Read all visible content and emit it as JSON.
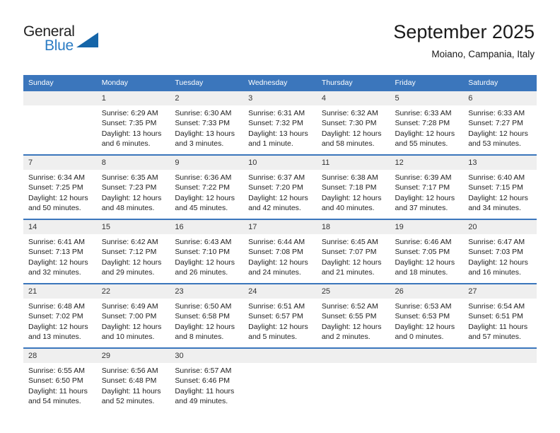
{
  "brand": {
    "name_top": "General",
    "name_bottom": "Blue",
    "triangle_color": "#1565a8",
    "blue_color": "#2b7cc4"
  },
  "header": {
    "title": "September 2025",
    "subtitle": "Moiano, Campania, Italy"
  },
  "theme": {
    "header_bar_color": "#3b76bc",
    "daynum_bg": "#efefef",
    "text_color": "#222222"
  },
  "weekdays": [
    "Sunday",
    "Monday",
    "Tuesday",
    "Wednesday",
    "Thursday",
    "Friday",
    "Saturday"
  ],
  "weeks": [
    [
      {
        "day": "",
        "lines": []
      },
      {
        "day": "1",
        "lines": [
          "Sunrise: 6:29 AM",
          "Sunset: 7:35 PM",
          "Daylight: 13 hours",
          "and 6 minutes."
        ]
      },
      {
        "day": "2",
        "lines": [
          "Sunrise: 6:30 AM",
          "Sunset: 7:33 PM",
          "Daylight: 13 hours",
          "and 3 minutes."
        ]
      },
      {
        "day": "3",
        "lines": [
          "Sunrise: 6:31 AM",
          "Sunset: 7:32 PM",
          "Daylight: 13 hours",
          "and 1 minute."
        ]
      },
      {
        "day": "4",
        "lines": [
          "Sunrise: 6:32 AM",
          "Sunset: 7:30 PM",
          "Daylight: 12 hours",
          "and 58 minutes."
        ]
      },
      {
        "day": "5",
        "lines": [
          "Sunrise: 6:33 AM",
          "Sunset: 7:28 PM",
          "Daylight: 12 hours",
          "and 55 minutes."
        ]
      },
      {
        "day": "6",
        "lines": [
          "Sunrise: 6:33 AM",
          "Sunset: 7:27 PM",
          "Daylight: 12 hours",
          "and 53 minutes."
        ]
      }
    ],
    [
      {
        "day": "7",
        "lines": [
          "Sunrise: 6:34 AM",
          "Sunset: 7:25 PM",
          "Daylight: 12 hours",
          "and 50 minutes."
        ]
      },
      {
        "day": "8",
        "lines": [
          "Sunrise: 6:35 AM",
          "Sunset: 7:23 PM",
          "Daylight: 12 hours",
          "and 48 minutes."
        ]
      },
      {
        "day": "9",
        "lines": [
          "Sunrise: 6:36 AM",
          "Sunset: 7:22 PM",
          "Daylight: 12 hours",
          "and 45 minutes."
        ]
      },
      {
        "day": "10",
        "lines": [
          "Sunrise: 6:37 AM",
          "Sunset: 7:20 PM",
          "Daylight: 12 hours",
          "and 42 minutes."
        ]
      },
      {
        "day": "11",
        "lines": [
          "Sunrise: 6:38 AM",
          "Sunset: 7:18 PM",
          "Daylight: 12 hours",
          "and 40 minutes."
        ]
      },
      {
        "day": "12",
        "lines": [
          "Sunrise: 6:39 AM",
          "Sunset: 7:17 PM",
          "Daylight: 12 hours",
          "and 37 minutes."
        ]
      },
      {
        "day": "13",
        "lines": [
          "Sunrise: 6:40 AM",
          "Sunset: 7:15 PM",
          "Daylight: 12 hours",
          "and 34 minutes."
        ]
      }
    ],
    [
      {
        "day": "14",
        "lines": [
          "Sunrise: 6:41 AM",
          "Sunset: 7:13 PM",
          "Daylight: 12 hours",
          "and 32 minutes."
        ]
      },
      {
        "day": "15",
        "lines": [
          "Sunrise: 6:42 AM",
          "Sunset: 7:12 PM",
          "Daylight: 12 hours",
          "and 29 minutes."
        ]
      },
      {
        "day": "16",
        "lines": [
          "Sunrise: 6:43 AM",
          "Sunset: 7:10 PM",
          "Daylight: 12 hours",
          "and 26 minutes."
        ]
      },
      {
        "day": "17",
        "lines": [
          "Sunrise: 6:44 AM",
          "Sunset: 7:08 PM",
          "Daylight: 12 hours",
          "and 24 minutes."
        ]
      },
      {
        "day": "18",
        "lines": [
          "Sunrise: 6:45 AM",
          "Sunset: 7:07 PM",
          "Daylight: 12 hours",
          "and 21 minutes."
        ]
      },
      {
        "day": "19",
        "lines": [
          "Sunrise: 6:46 AM",
          "Sunset: 7:05 PM",
          "Daylight: 12 hours",
          "and 18 minutes."
        ]
      },
      {
        "day": "20",
        "lines": [
          "Sunrise: 6:47 AM",
          "Sunset: 7:03 PM",
          "Daylight: 12 hours",
          "and 16 minutes."
        ]
      }
    ],
    [
      {
        "day": "21",
        "lines": [
          "Sunrise: 6:48 AM",
          "Sunset: 7:02 PM",
          "Daylight: 12 hours",
          "and 13 minutes."
        ]
      },
      {
        "day": "22",
        "lines": [
          "Sunrise: 6:49 AM",
          "Sunset: 7:00 PM",
          "Daylight: 12 hours",
          "and 10 minutes."
        ]
      },
      {
        "day": "23",
        "lines": [
          "Sunrise: 6:50 AM",
          "Sunset: 6:58 PM",
          "Daylight: 12 hours",
          "and 8 minutes."
        ]
      },
      {
        "day": "24",
        "lines": [
          "Sunrise: 6:51 AM",
          "Sunset: 6:57 PM",
          "Daylight: 12 hours",
          "and 5 minutes."
        ]
      },
      {
        "day": "25",
        "lines": [
          "Sunrise: 6:52 AM",
          "Sunset: 6:55 PM",
          "Daylight: 12 hours",
          "and 2 minutes."
        ]
      },
      {
        "day": "26",
        "lines": [
          "Sunrise: 6:53 AM",
          "Sunset: 6:53 PM",
          "Daylight: 12 hours",
          "and 0 minutes."
        ]
      },
      {
        "day": "27",
        "lines": [
          "Sunrise: 6:54 AM",
          "Sunset: 6:51 PM",
          "Daylight: 11 hours",
          "and 57 minutes."
        ]
      }
    ],
    [
      {
        "day": "28",
        "lines": [
          "Sunrise: 6:55 AM",
          "Sunset: 6:50 PM",
          "Daylight: 11 hours",
          "and 54 minutes."
        ]
      },
      {
        "day": "29",
        "lines": [
          "Sunrise: 6:56 AM",
          "Sunset: 6:48 PM",
          "Daylight: 11 hours",
          "and 52 minutes."
        ]
      },
      {
        "day": "30",
        "lines": [
          "Sunrise: 6:57 AM",
          "Sunset: 6:46 PM",
          "Daylight: 11 hours",
          "and 49 minutes."
        ]
      },
      {
        "day": "",
        "lines": []
      },
      {
        "day": "",
        "lines": []
      },
      {
        "day": "",
        "lines": []
      },
      {
        "day": "",
        "lines": []
      }
    ]
  ]
}
